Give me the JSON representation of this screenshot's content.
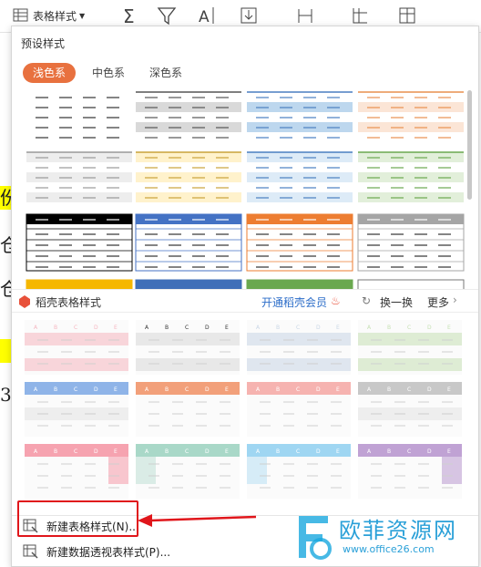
{
  "toolbar": {
    "table_style_label": "表格样式"
  },
  "sheet": {
    "cells": [
      "份",
      "仓",
      "仓",
      "",
      "3"
    ]
  },
  "panel": {
    "preset_title": "预设样式",
    "tabs": [
      "浅色系",
      "中色系",
      "深色系"
    ],
    "active_tab": "浅色系",
    "premium_title": "稻壳表格样式",
    "premium_link": "开通稻壳会员",
    "refresh": "换一换",
    "more": "更多",
    "col_letters": [
      "A",
      "B",
      "C",
      "D",
      "E"
    ],
    "new_style": "新建表格样式(N)...",
    "new_pivot_style": "新建数据透视表样式(P)..."
  },
  "watermark": {
    "name": "欧菲资源网",
    "url": "www.office26.com"
  },
  "colors": {
    "accent": "#e8713f",
    "red_highlight": "#e0161b",
    "preset_row1": [
      "#ffffff",
      "#d9d9d9",
      "#bdd7ee",
      "#fbe5d6"
    ],
    "preset_row2": [
      "#ededed",
      "#fff2cc",
      "#ddebf7",
      "#e2efda"
    ],
    "preset_row3": [
      "#000000",
      "#4472c4",
      "#ed7d31",
      "#a5a5a5"
    ],
    "premium_header": [
      "#f5b6c0",
      "#d9d9d9",
      "#c9d6e6",
      "#c6e0b4",
      "#8fb4e8",
      "#f2a07a",
      "#f6b3b0",
      "#c8c8c8",
      "#f6a3b0",
      "#a9d8c8",
      "#9fd6f2",
      "#c0a2d4"
    ]
  }
}
